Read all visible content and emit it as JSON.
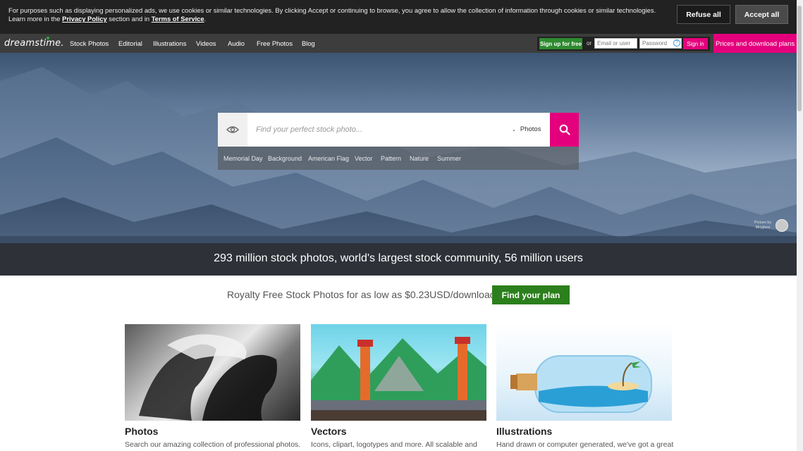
{
  "cookie": {
    "text_1": "For purposes such as displaying personalized ads, we use cookies or similar technologies. By clicking Accept or continuing to browse, you agree to allow the collection of information through cookies or similar technologies. Learn more in the ",
    "privacy_link": "Privacy Policy",
    "text_2": " section and in ",
    "terms_link": "Terms of Service",
    "text_3": ".",
    "refuse_label": "Refuse all",
    "accept_label": "Accept all"
  },
  "nav": {
    "logo": "dreamstime.",
    "items": [
      "Stock Photos",
      "Editorial",
      "Illustrations",
      "Videos",
      "Audio",
      "Free Photos",
      "Blog"
    ],
    "signup_label": "Sign up for free",
    "or_label": "or",
    "email_placeholder": "Email or user",
    "password_placeholder": "Password",
    "help_label": "?",
    "signin_label": "Sign in",
    "prices_label": "Prices and download plans"
  },
  "search": {
    "placeholder": "Find your perfect stock photo...",
    "type_label": "Photos",
    "suggestions": [
      "Memorial Day",
      "Background",
      "American Flag",
      "Vector",
      "Pattern",
      "Nature",
      "Summer"
    ]
  },
  "hero": {
    "credit_line1": "Picture by",
    "credit_line2": "Mnyjhee",
    "stats": "293 million stock photos, world's largest stock community, 56 million users"
  },
  "promo": {
    "text": "Royalty Free Stock Photos for as low as $0.23USD/download or free",
    "button_label": "Find your plan"
  },
  "cards": [
    {
      "title": "Photos",
      "desc": "Search our amazing collection of professional photos."
    },
    {
      "title": "Vectors",
      "desc": "Icons, clipart, logotypes and more. All scalable and"
    },
    {
      "title": "Illustrations",
      "desc": "Hand drawn or computer generated, we've got a great"
    }
  ],
  "colors": {
    "brand_pink": "#e4007c",
    "brand_green": "#2b7f1c",
    "dark_bar": "#222222"
  }
}
